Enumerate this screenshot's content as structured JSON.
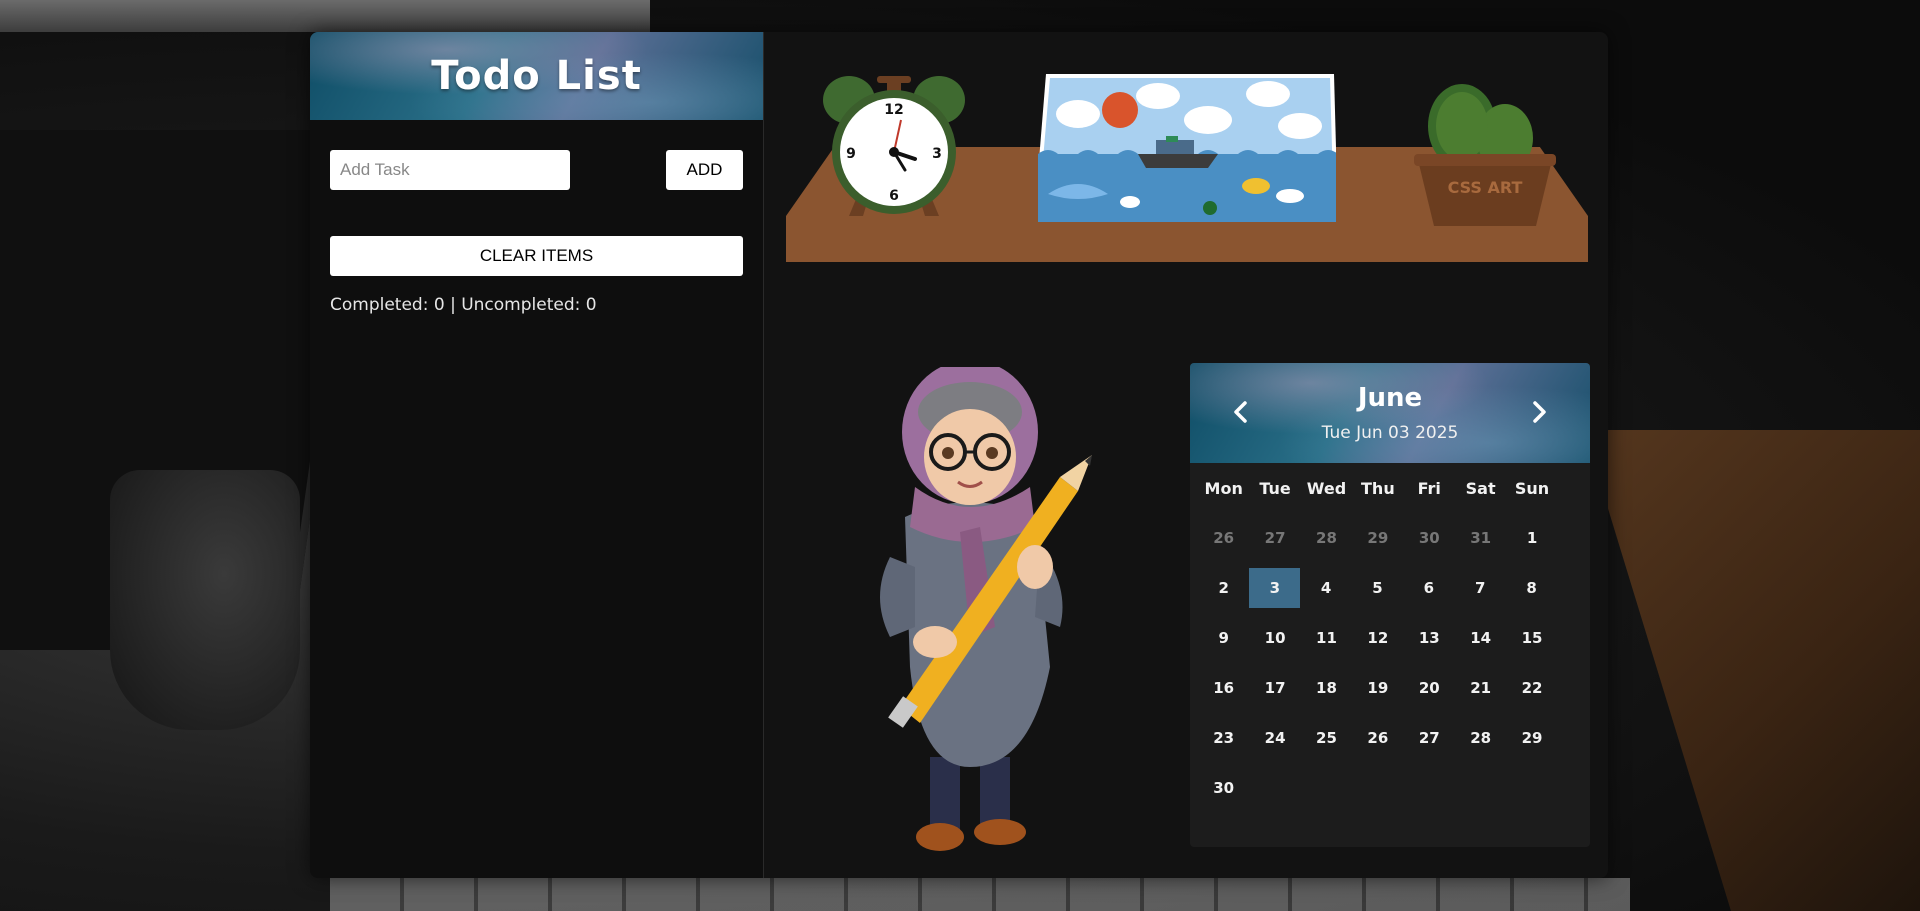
{
  "sidebar": {
    "title": "Todo List",
    "task_input_placeholder": "Add Task",
    "add_label": "ADD",
    "clear_label": "CLEAR ITEMS",
    "stats": "Completed: 0 | Uncompleted: 0"
  },
  "scene": {
    "clock_numbers": [
      "12",
      "3",
      "6",
      "9"
    ],
    "cactus_label": "CSS ART"
  },
  "calendar": {
    "month": "June",
    "current_date": "Tue Jun 03 2025",
    "weekdays": [
      "Mon",
      "Tue",
      "Wed",
      "Thu",
      "Fri",
      "Sat",
      "Sun"
    ],
    "weeks": [
      [
        "26",
        "27",
        "28",
        "29",
        "30",
        "31",
        "1"
      ],
      [
        "2",
        "3",
        "4",
        "5",
        "6",
        "7",
        "8"
      ],
      [
        "9",
        "10",
        "11",
        "12",
        "13",
        "14",
        "15"
      ],
      [
        "16",
        "17",
        "18",
        "19",
        "20",
        "21",
        "22"
      ],
      [
        "23",
        "24",
        "25",
        "26",
        "27",
        "28",
        "29"
      ],
      [
        "30",
        "",
        "",
        "",
        "",
        "",
        ""
      ]
    ],
    "today": "3",
    "colors": {
      "today_bg": "#3c6b8a",
      "muted_text": "#777777"
    }
  },
  "icons": [
    "chevron-left-icon",
    "chevron-right-icon",
    "alarm-clock-icon",
    "cactus-icon",
    "picture-icon",
    "character-illustration"
  ]
}
